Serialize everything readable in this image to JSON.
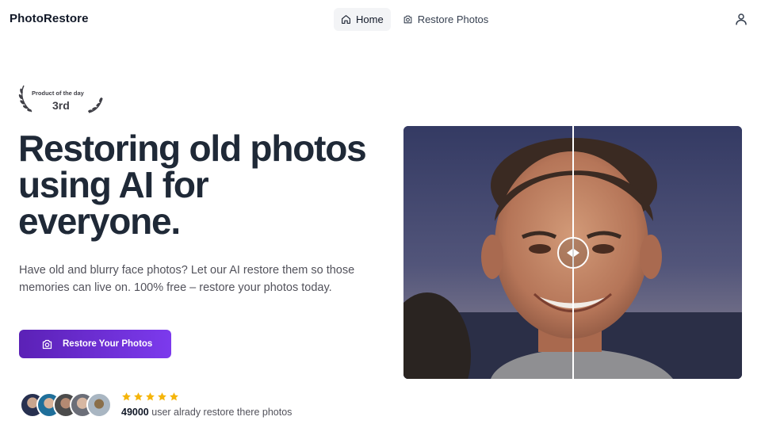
{
  "header": {
    "brand": "PhotoRestore",
    "nav": [
      {
        "label": "Home",
        "icon": "home-icon",
        "active": true
      },
      {
        "label": "Restore Photos",
        "icon": "camera-icon",
        "active": false
      }
    ],
    "user_icon": "user-icon"
  },
  "badge": {
    "title": "Product of the day",
    "rank": "3rd"
  },
  "hero": {
    "title": "Restoring old photos using AI for everyone.",
    "subtitle": "Have old and blurry face photos? Let our AI restore them so those memories can live on. 100% free – restore your photos today.",
    "cta_label": "Restore Your Photos",
    "cta_icon": "camera-icon"
  },
  "social_proof": {
    "avatars_count": 5,
    "stars": 5,
    "count": "49000",
    "text": "user alrady restore there photos"
  },
  "colors": {
    "accent": "#6d28d9",
    "star": "#f5b50a",
    "text": "#1f2937"
  },
  "comparison": {
    "slider_position": 0.5
  }
}
